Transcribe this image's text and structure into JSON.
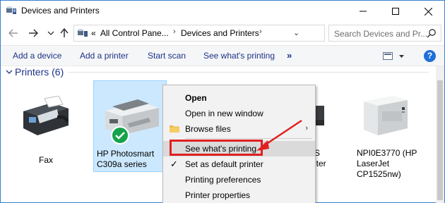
{
  "window": {
    "title": "Devices and Printers"
  },
  "address": {
    "overflow": "«",
    "segment1": "All Control Pane...",
    "segment2": "Devices and Printers",
    "search_placeholder": "Search Devices and Pr..."
  },
  "toolbar": {
    "add_device": "Add a device",
    "add_printer": "Add a printer",
    "start_scan": "Start scan",
    "see_printing": "See what's printing",
    "more": "»",
    "help": "?"
  },
  "group": {
    "header": "Printers (6)"
  },
  "devices": [
    {
      "label": "Fax"
    },
    {
      "label": "HP Photosmart C309a series"
    },
    {
      "label": "S"
    },
    {
      "label": "riter"
    },
    {
      "label": "NPI0E3770 (HP LaserJet CP1525nw)"
    }
  ],
  "menu": {
    "items": [
      {
        "label": "Open"
      },
      {
        "label": "Open in new window"
      },
      {
        "label": "Browse files"
      },
      {
        "label": "See what's printing"
      },
      {
        "label": "Set as default printer"
      },
      {
        "label": "Printing preferences"
      },
      {
        "label": "Printer properties"
      }
    ]
  },
  "colors": {
    "accent": "#1e3287",
    "selection": "#cce8ff",
    "annotation": "#e02020"
  }
}
